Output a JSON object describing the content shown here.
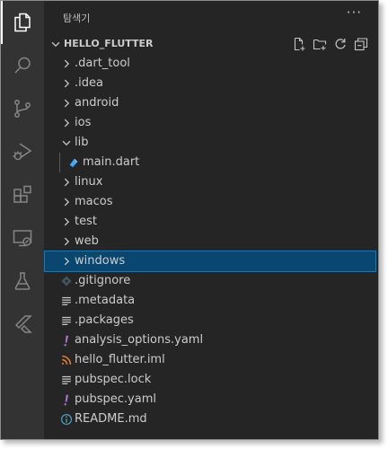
{
  "sidebar": {
    "title": "탐색기",
    "more": "···"
  },
  "section": {
    "title": "HELLO_FLUTTER"
  },
  "tree": [
    {
      "label": ".dart_tool",
      "kind": "folder"
    },
    {
      "label": ".idea",
      "kind": "folder"
    },
    {
      "label": "android",
      "kind": "folder"
    },
    {
      "label": "ios",
      "kind": "folder"
    },
    {
      "label": "lib",
      "kind": "folder-open"
    },
    {
      "label": "main.dart",
      "kind": "dart"
    },
    {
      "label": "linux",
      "kind": "folder"
    },
    {
      "label": "macos",
      "kind": "folder"
    },
    {
      "label": "test",
      "kind": "folder"
    },
    {
      "label": "web",
      "kind": "folder"
    },
    {
      "label": "windows",
      "kind": "folder",
      "selected": true
    },
    {
      "label": ".gitignore",
      "kind": "git"
    },
    {
      "label": ".metadata",
      "kind": "lines"
    },
    {
      "label": ".packages",
      "kind": "lines"
    },
    {
      "label": "analysis_options.yaml",
      "kind": "yaml"
    },
    {
      "label": "hello_flutter.iml",
      "kind": "rss"
    },
    {
      "label": "pubspec.lock",
      "kind": "lines"
    },
    {
      "label": "pubspec.yaml",
      "kind": "yaml"
    },
    {
      "label": "README.md",
      "kind": "info"
    }
  ],
  "colors": {
    "selection": "#094771",
    "dart": "#42a5f5",
    "yaml": "#a074c4",
    "iml": "#e37933",
    "info": "#519aba"
  }
}
